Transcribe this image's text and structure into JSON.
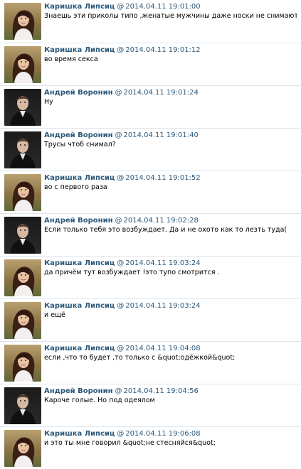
{
  "messages": [
    {
      "author": "Каришка Липсиц",
      "at": "@",
      "time": "2014.04.11 19:01:00",
      "text": "Знаешь эти приколы типо ,женатые мужчины даже носки не снимают.",
      "avatar": "female-portrait-icon"
    },
    {
      "author": "Каришка Липсиц",
      "at": "@",
      "time": "2014.04.11 19:01:12",
      "text": "во время секса",
      "avatar": "female-portrait-icon"
    },
    {
      "author": "Андрей Воронин",
      "at": "@",
      "time": "2014.04.11 19:01:24",
      "text": "Ну",
      "avatar": "male-portrait-icon"
    },
    {
      "author": "Андрей Воронин",
      "at": "@",
      "time": "2014.04.11 19:01:40",
      "text": "Трусы чтоб снимал?",
      "avatar": "male-portrait-icon"
    },
    {
      "author": "Каришка Липсиц",
      "at": "@",
      "time": "2014.04.11 19:01:52",
      "text": "во с первого раза",
      "avatar": "female-portrait-icon"
    },
    {
      "author": "Андрей Воронин",
      "at": "@",
      "time": "2014.04.11 19:02:28",
      "text": "Если только тебя это возбуждает. Да и не охото как то лезть туда(",
      "avatar": "male-portrait-icon"
    },
    {
      "author": "Каришка Липсиц",
      "at": "@",
      "time": "2014.04.11 19:03:24",
      "text": "да причём тут возбуждает !это тупо смотрится .",
      "avatar": "female-portrait-icon"
    },
    {
      "author": "Каришка Липсиц",
      "at": "@",
      "time": "2014.04.11 19:03:24",
      "text": "и ещё",
      "avatar": "female-portrait-icon"
    },
    {
      "author": "Каришка Липсиц",
      "at": "@",
      "time": "2014.04.11 19:04:08",
      "text": "если ,что то будет ,то только с &quot;одёжкой&quot;",
      "avatar": "female-portrait-icon"
    },
    {
      "author": "Андрей Воронин",
      "at": "@",
      "time": "2014.04.11 19:04:56",
      "text": "Кароче голые. Но под одеялом",
      "avatar": "male-portrait-icon"
    },
    {
      "author": "Каришка Липсиц",
      "at": "@",
      "time": "2014.04.11 19:06:08",
      "text": "и это ты мне говорил &quot;не стесняйся&quot;",
      "avatar": "female-portrait-icon"
    }
  ],
  "colors": {
    "link": "#2b587a",
    "text": "#000000",
    "separator": "#dfe5ec"
  }
}
